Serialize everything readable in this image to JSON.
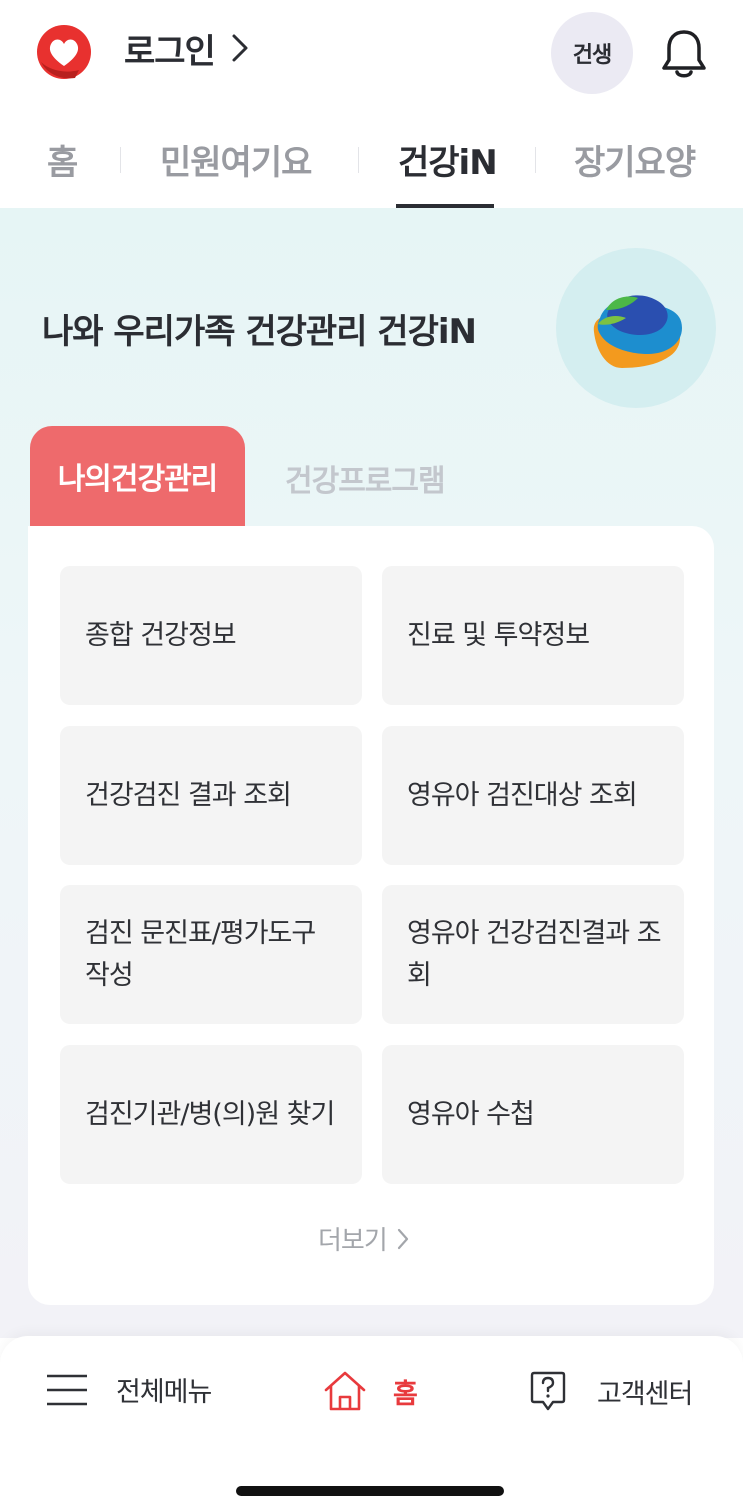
{
  "header": {
    "login_label": "로그인",
    "avatar_label": "건생"
  },
  "tabs": [
    {
      "label": "홈"
    },
    {
      "label": "민원여기요"
    },
    {
      "label": "건강iN",
      "active": true
    },
    {
      "label": "장기요양"
    }
  ],
  "hero": {
    "title": "나와 우리가족 건강관리 건강iN"
  },
  "subtabs": {
    "active": "나의건강관리",
    "inactive": "건강프로그램"
  },
  "tiles": [
    "종합 건강정보",
    "진료 및 투약정보",
    "건강검진 결과 조회",
    "영유아 검진대상 조회",
    "검진 문진표/평가도구 작성",
    "영유아 건강검진결과 조회",
    "검진기관/병(의)원 찾기",
    "영유아 수첩"
  ],
  "more_label": "더보기",
  "bottom_nav": {
    "menu": "전체메뉴",
    "home": "홈",
    "support": "고객센터"
  },
  "colors": {
    "accent_red": "#ee6a6c",
    "home_red": "#e83a3d",
    "text_dark": "#2b2d33"
  }
}
